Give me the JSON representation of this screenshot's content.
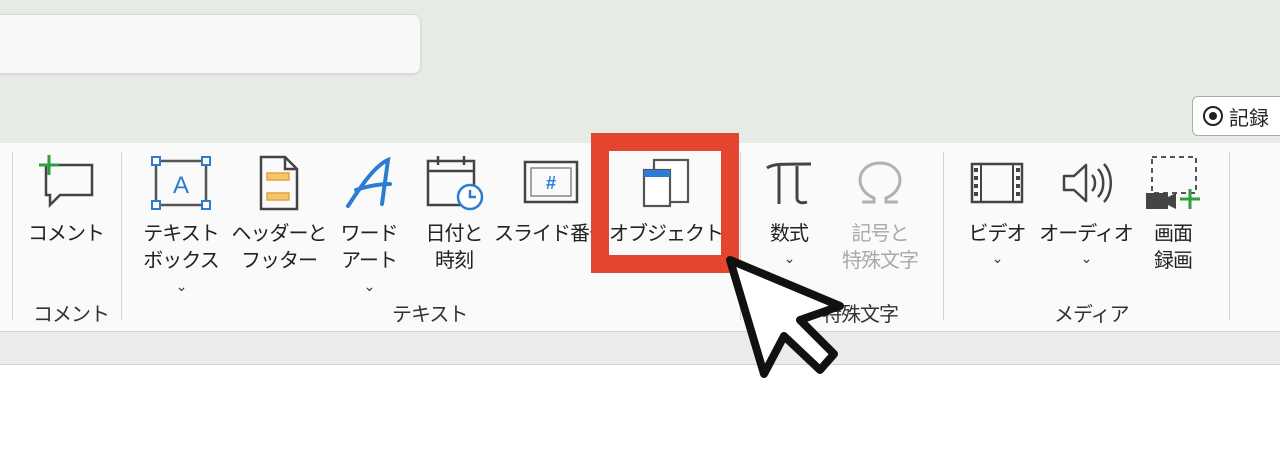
{
  "header": {
    "record_label": "記録"
  },
  "ribbon": {
    "comment": {
      "label": "コメント"
    },
    "textbox": {
      "line1": "テキスト",
      "line2": "ボックス"
    },
    "header_footer": {
      "line1": "ヘッダーと",
      "line2": "フッター"
    },
    "wordart": {
      "line1": "ワード",
      "line2": "アート"
    },
    "datetime": {
      "line1": "日付と",
      "line2": "時刻"
    },
    "slide_number": {
      "label": "スライド番号"
    },
    "object": {
      "label": "オブジェクト"
    },
    "equation": {
      "label": "数式"
    },
    "symbol": {
      "line1": "記号と",
      "line2": "特殊文字"
    },
    "video": {
      "label": "ビデオ"
    },
    "audio": {
      "label": "オーディオ"
    },
    "screen_recording": {
      "line1": "画面",
      "line2": "録画"
    },
    "groups": {
      "comment": "コメント",
      "text": "テキスト",
      "symbols": "特殊文字",
      "media": "メディア"
    },
    "chevron": "⌄"
  },
  "colors": {
    "highlight": "#e4452e",
    "accent_blue": "#2b7cd3",
    "accent_green": "#2e9e3e",
    "accent_orange": "#e8a33a"
  }
}
